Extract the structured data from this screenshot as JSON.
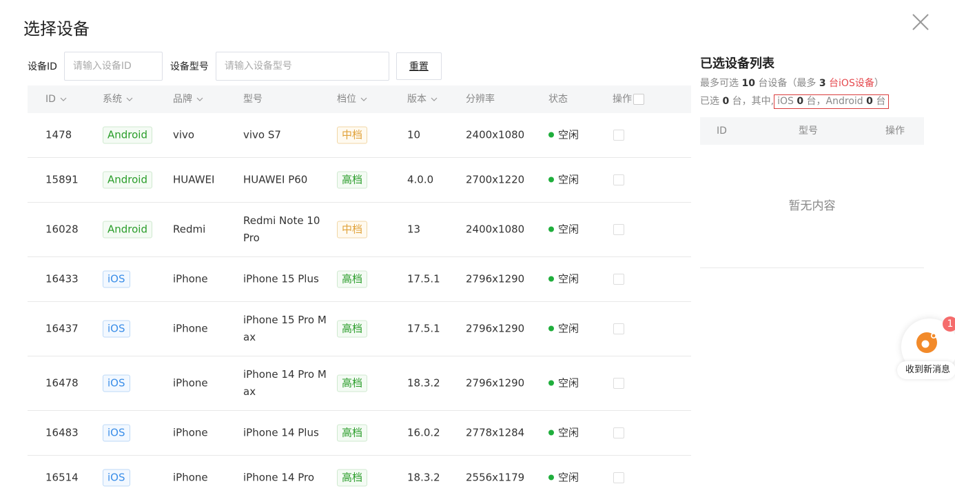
{
  "dialog": {
    "title": "选择设备"
  },
  "filters": {
    "id_label": "设备ID",
    "id_placeholder": "请输入设备ID",
    "model_label": "设备型号",
    "model_placeholder": "请输入设备型号",
    "reset_label": "重置"
  },
  "table": {
    "columns": [
      "ID",
      "系统",
      "品牌",
      "型号",
      "档位",
      "版本",
      "分辨率",
      "状态",
      "操作"
    ],
    "rows": [
      {
        "id": "1478",
        "os": "Android",
        "brand": "vivo",
        "model": "vivo S7",
        "tier": "中档",
        "version": "10",
        "resolution": "2400x1080",
        "status": "空闲"
      },
      {
        "id": "15891",
        "os": "Android",
        "brand": "HUAWEI",
        "model": "HUAWEI P60",
        "tier": "高档",
        "version": "4.0.0",
        "resolution": "2700x1220",
        "status": "空闲"
      },
      {
        "id": "16028",
        "os": "Android",
        "brand": "Redmi",
        "model": "Redmi Note 10 Pro",
        "tier": "中档",
        "version": "13",
        "resolution": "2400x1080",
        "status": "空闲"
      },
      {
        "id": "16433",
        "os": "iOS",
        "brand": "iPhone",
        "model": "iPhone 15 Plus",
        "tier": "高档",
        "version": "17.5.1",
        "resolution": "2796x1290",
        "status": "空闲"
      },
      {
        "id": "16437",
        "os": "iOS",
        "brand": "iPhone",
        "model": "iPhone 15 Pro Max",
        "tier": "高档",
        "version": "17.5.1",
        "resolution": "2796x1290",
        "status": "空闲"
      },
      {
        "id": "16478",
        "os": "iOS",
        "brand": "iPhone",
        "model": "iPhone 14 Pro Max",
        "tier": "高档",
        "version": "18.3.2",
        "resolution": "2796x1290",
        "status": "空闲"
      },
      {
        "id": "16483",
        "os": "iOS",
        "brand": "iPhone",
        "model": "iPhone 14 Plus",
        "tier": "高档",
        "version": "16.0.2",
        "resolution": "2778x1284",
        "status": "空闲"
      },
      {
        "id": "16514",
        "os": "iOS",
        "brand": "iPhone",
        "model": "iPhone 14 Pro",
        "tier": "高档",
        "version": "18.3.2",
        "resolution": "2556x1179",
        "status": "空闲"
      }
    ]
  },
  "selected": {
    "title": "已选设备列表",
    "limit_prefix": "最多可选 ",
    "limit_count": "10",
    "limit_mid": " 台设备（最多 ",
    "ios_limit": "3",
    "ios_limit_suffix": " 台iOS设备",
    "limit_close": "）",
    "selected_prefix": "已选 ",
    "selected_count": "0",
    "selected_mid": " 台，其中,",
    "ios_label": "iOS ",
    "ios_count": "0",
    "android_label": " 台，Android ",
    "android_count": "0",
    "unit": " 台",
    "columns": [
      "ID",
      "型号",
      "操作"
    ],
    "empty_text": "暂无内容"
  },
  "notification": {
    "badge": "1",
    "label": "收到新消息"
  },
  "colors": {
    "status_idle": "#1fae3c",
    "accent_red": "#e5484d"
  }
}
